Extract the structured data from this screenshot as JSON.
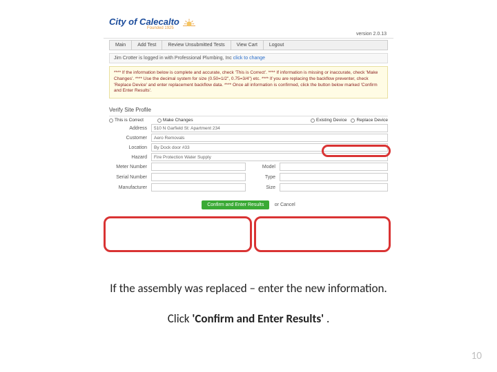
{
  "brand": {
    "name": "City of Calecalto",
    "founded": "Founded 1925"
  },
  "version": "version 2.0.13",
  "nav": [
    "Main",
    "Add Test",
    "Review Unsubmitted Tests",
    "View Cart",
    "Logout"
  ],
  "login": {
    "prefix": "Jim Crotter is logged in with Professional Plumbing, Inc",
    "link": "click to change"
  },
  "notice": "**** If the information below is complete and accurate, check 'This is Correct'. **** If information is missing or inaccurate, check 'Make Changes'. **** Use the decimal system for size (0.50=1/2\", 0.75=3/4\") etc. **** If you are replacing the backflow preventer, check 'Replace Device' and enter replacement backflow data. **** Once all information is confirmed, click the button below marked 'Confirm and Enter Results'.",
  "section": "Verify Site Profile",
  "radios": {
    "left": [
      "This is Correct",
      "Make Changes"
    ],
    "right": [
      "Existing Device",
      "Replace Device"
    ]
  },
  "fields": {
    "address": {
      "label": "Address",
      "value": "510 N Garfield St: Apartment 234"
    },
    "customer": {
      "label": "Customer",
      "value": "Aero Removals"
    },
    "location": {
      "label": "Location",
      "value": "By Dock door #33"
    },
    "hazard": {
      "label": "Hazard",
      "value": "Fire Protection Water Supply"
    },
    "meter": {
      "label": "Meter Number",
      "value": ""
    },
    "serial": {
      "label": "Serial Number",
      "value": ""
    },
    "manuf": {
      "label": "Manufacturer",
      "value": ""
    },
    "model": {
      "label": "Model",
      "value": ""
    },
    "type": {
      "label": "Type",
      "value": ""
    },
    "size": {
      "label": "Size",
      "value": ""
    }
  },
  "actions": {
    "confirm": "Confirm and Enter Results",
    "or": "or Cancel"
  },
  "captions": {
    "line1": "If the assembly was replaced – enter the new information.",
    "line2_pre": "Click ",
    "line2_bold": "'Confirm and Enter Results'",
    "line2_post": " ."
  },
  "page": "10"
}
